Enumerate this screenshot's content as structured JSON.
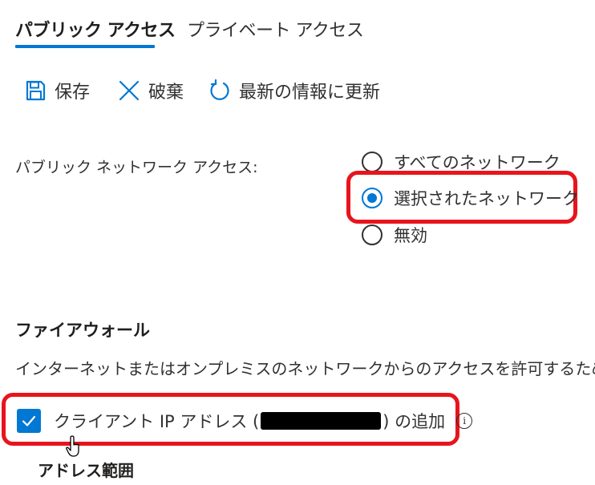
{
  "tabs": [
    {
      "label": "パブリック アクセス",
      "active": true
    },
    {
      "label": "プライベート アクセス",
      "active": false
    }
  ],
  "toolbar": {
    "save_label": "保存",
    "discard_label": "破棄",
    "refresh_label": "最新の情報に更新",
    "save_icon": "save-icon",
    "discard_icon": "close-icon",
    "refresh_icon": "refresh-icon"
  },
  "network_access": {
    "label": "パブリック ネットワーク アクセス:",
    "options": [
      {
        "label": "すべてのネットワーク",
        "checked": false
      },
      {
        "label": "選択されたネットワーク",
        "checked": true
      },
      {
        "label": "無効",
        "checked": false
      }
    ]
  },
  "firewall": {
    "title": "ファイアウォール",
    "description": "インターネットまたはオンプレミスのネットワークからのアクセスを許可するための IP 範囲",
    "checkbox_prefix": "クライアント IP アドレス (",
    "checkbox_suffix": ") の追加",
    "checkbox_checked": true
  },
  "address_range": {
    "title": "アドレス範囲"
  },
  "colors": {
    "accent": "#0078d4",
    "highlight": "#e8141c",
    "text": "#323130"
  }
}
